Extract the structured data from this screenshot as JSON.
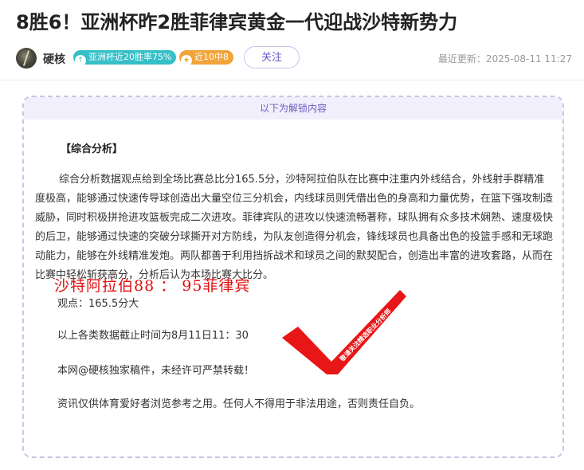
{
  "article": {
    "title": "8胜6！亚洲杯昨2胜菲律宾黄金一代迎战沙特新势力"
  },
  "author": {
    "name": "硬核",
    "badges": [
      {
        "icon": "arrow-up-icon",
        "text": "亚洲杯近20胜率75%",
        "color": "#36bfc7"
      },
      {
        "icon": "star-icon",
        "text": "近10中8",
        "color": "#f0a43a"
      }
    ],
    "follow_label": "关注",
    "update_time": "最近更新：2025-08-11 11:27"
  },
  "locked_content": {
    "header": "以下为解锁内容",
    "section_title": "【综合分析】",
    "paragraph": "综合分析数据观点给到全场比赛总比分165.5分，沙特阿拉伯队在比赛中注重内外线结合，外线射手群精准度极高，能够通过快速传导球创造出大量空位三分机会，内线球员则凭借出色的身高和力量优势，在篮下强攻制造威胁，同时积极拼抢进攻篮板完成二次进攻。菲律宾队的进攻以快速流畅著称，球队拥有众多技术娴熟、速度极快的后卫，能够通过快速的突破分球撕开对方防线，为队友创造得分机会，锋线球员也具备出色的投篮手感和无球跑动能力，能够在外线精准发炮。两队都善于利用挡拆战术和球员之间的默契配合，创造出丰富的进攻套路，从而在比赛中轻松斩获高分，分析后认为本场比赛大比分。",
    "view_line": "观点：165.5分大",
    "cutoff_line": "以上各类数据截止时间为8月11日11：30",
    "copyright_line": "本网@硬核独家稿件，未经许可严禁转载！",
    "disclaimer_line": "资讯仅供体育爱好者浏览参考之用。任何人不得用于非法用途，否则责任自负。",
    "score_overlay": "沙特阿拉伯88 ： 95菲律宾",
    "stamp_text": "敬请关注精选职业分析师"
  },
  "colors": {
    "accent_purple": "#6b5fbf",
    "stamp_red": "#e01010",
    "badge_teal": "#36bfc7",
    "badge_orange": "#f0a43a"
  }
}
